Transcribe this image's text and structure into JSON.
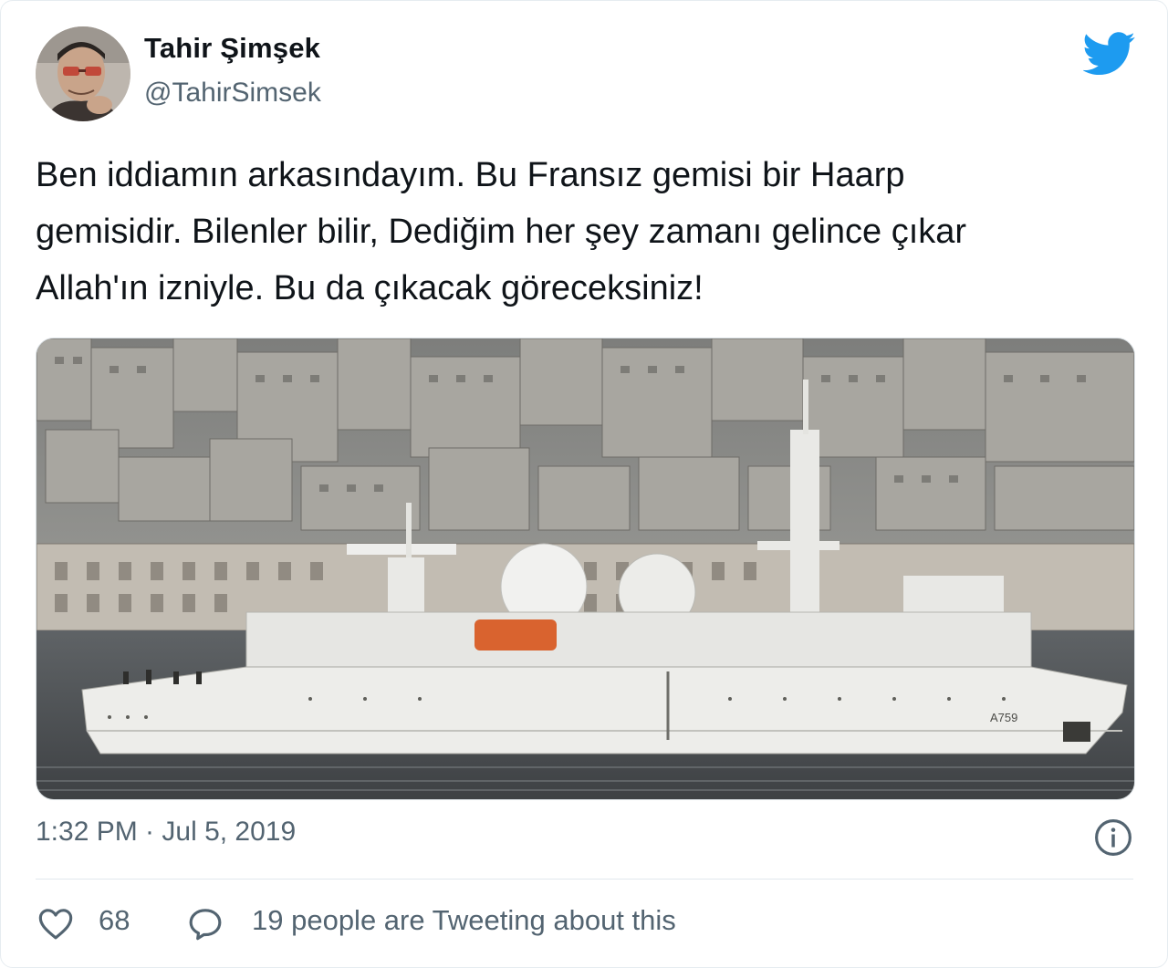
{
  "author": {
    "display_name": "Tahir Şimşek",
    "handle": "@TahirSimsek"
  },
  "icons": {
    "brand": "twitter-bird-icon",
    "info": "info-icon",
    "like": "heart-icon",
    "reply": "speech-bubble-icon"
  },
  "colors": {
    "brand": "#1d9bf0",
    "secondary_text": "#536471",
    "primary_text": "#0f1419"
  },
  "tweet": {
    "lines": [
      "Ben iddiamın arkasındayım. Bu Fransız gemisi bir Haarp",
      "gemisidir. Bilenler bilir, Dediğim her şey zamanı gelince çıkar",
      "Allah'ın izniyle. Bu da çıkacak göreceksiniz!"
    ],
    "image_hull_label": "A759"
  },
  "meta": {
    "timestamp": "1:32 PM · Jul 5, 2019"
  },
  "actions": {
    "likes": "68",
    "conversation": "19 people are Tweeting about this"
  }
}
